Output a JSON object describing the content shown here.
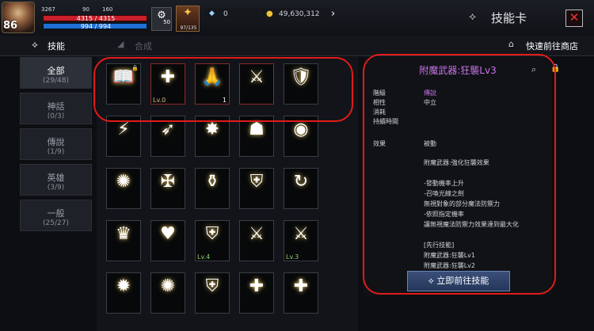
{
  "player": {
    "level": "86",
    "exp": "3267",
    "stat1": "90",
    "stat2": "160",
    "hp": "4315 / 4315",
    "mp": "994 / 994",
    "buff_count": "50",
    "buff2_text": "97/135"
  },
  "resources": {
    "gems": "0",
    "gold": "49,630,312"
  },
  "header": {
    "title": "技能卡",
    "close": "✕"
  },
  "tabs": {
    "skill": "技能",
    "synth": "合成",
    "shop": "快速前往商店"
  },
  "nav": [
    {
      "label": "全部",
      "count": "(29/48)"
    },
    {
      "label": "神話",
      "count": "(0/3)"
    },
    {
      "label": "傳說",
      "count": "(1/9)"
    },
    {
      "label": "英雄",
      "count": "(3/9)"
    },
    {
      "label": "一般",
      "count": "(25/27)"
    }
  ],
  "cells": [
    {
      "g": "📖",
      "lv": "",
      "cnt": ""
    },
    {
      "g": "✚",
      "lv": "Lv.0",
      "cnt": ""
    },
    {
      "g": "🙏",
      "lv": "",
      "cnt": "1"
    },
    {
      "g": "⚔",
      "lv": "",
      "cnt": ""
    },
    {
      "g": "🛡",
      "lv": "",
      "cnt": ""
    },
    {
      "g": "⚡",
      "lv": "",
      "cnt": ""
    },
    {
      "g": "➶",
      "lv": "",
      "cnt": ""
    },
    {
      "g": "✸",
      "lv": "",
      "cnt": ""
    },
    {
      "g": "☗",
      "lv": "",
      "cnt": ""
    },
    {
      "g": "◉",
      "lv": "",
      "cnt": ""
    },
    {
      "g": "✺",
      "lv": "",
      "cnt": ""
    },
    {
      "g": "✠",
      "lv": "",
      "cnt": ""
    },
    {
      "g": "⚱",
      "lv": "",
      "cnt": ""
    },
    {
      "g": "⛨",
      "lv": "",
      "cnt": ""
    },
    {
      "g": "↻",
      "lv": "",
      "cnt": ""
    },
    {
      "g": "♛",
      "lv": "",
      "cnt": ""
    },
    {
      "g": "♥",
      "lv": "",
      "cnt": ""
    },
    {
      "g": "⛨",
      "lv": "Lv.4",
      "cnt": ""
    },
    {
      "g": "⚔",
      "lv": "",
      "cnt": ""
    },
    {
      "g": "⚔",
      "lv": "Lv.3",
      "cnt": ""
    },
    {
      "g": "✹",
      "lv": "",
      "cnt": ""
    },
    {
      "g": "✺",
      "lv": "",
      "cnt": ""
    },
    {
      "g": "⛨",
      "lv": "",
      "cnt": ""
    },
    {
      "g": "✚",
      "lv": "",
      "cnt": ""
    },
    {
      "g": "✚",
      "lv": "",
      "cnt": ""
    }
  ],
  "detail": {
    "title": "附魔武器:狂襲Lv3",
    "rows": [
      [
        "階級",
        "傳說"
      ],
      [
        "相性",
        "中立"
      ],
      [
        "消耗",
        ""
      ],
      [
        "持續時間",
        ""
      ],
      [
        "效果",
        "被動"
      ]
    ],
    "desc": [
      "附魔武器:強化狂襲效果",
      "",
      "-發動機率上升",
      "-召喚光線之劍",
      "無視對象的部分魔法防禦力",
      "-依照指定機率",
      "讓無視魔法防禦力效果達到最大化",
      "",
      "[先行技能]",
      "附魔武器:狂襲Lv1",
      "附魔武器:狂襲Lv2"
    ],
    "button": "立即前往技能"
  }
}
